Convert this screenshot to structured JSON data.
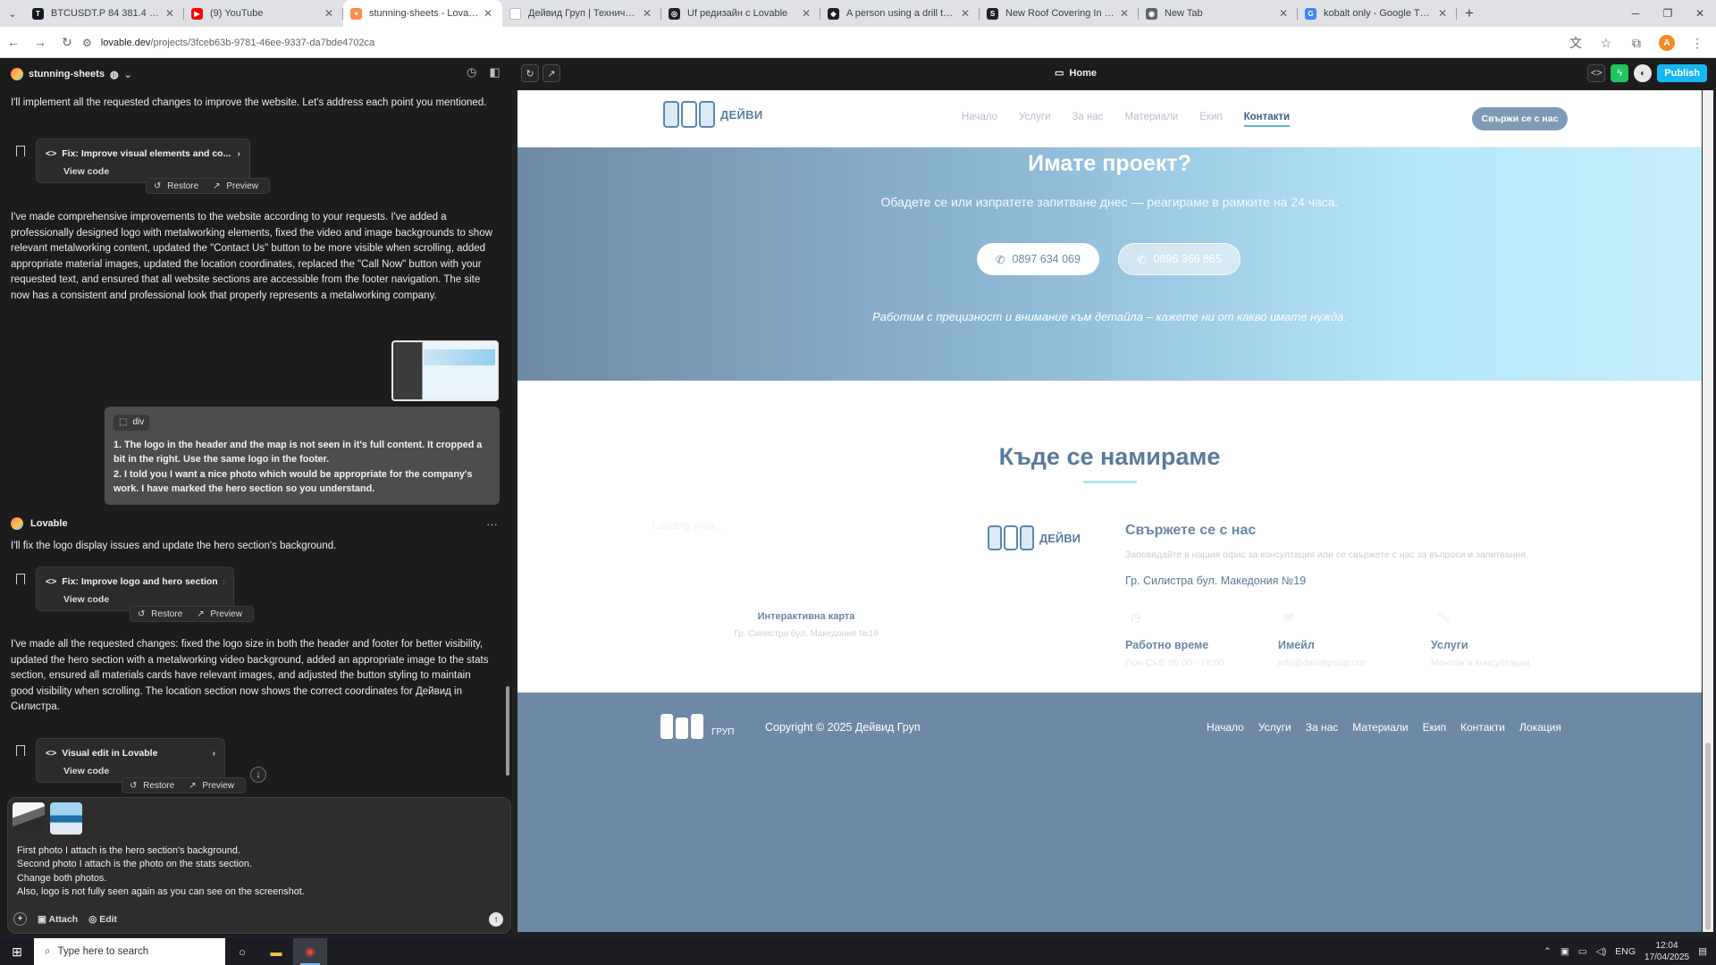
{
  "browser": {
    "tabs": [
      {
        "title": "BTCUSDT.P 84 381.4 ▲ -0.47%",
        "fav_color": "#131722",
        "fav_glyph": "T",
        "active": false
      },
      {
        "title": "(9) YouTube",
        "fav_color": "#ff0000",
        "fav_glyph": "▶",
        "active": false
      },
      {
        "title": "stunning-sheets - Lovable",
        "fav_color": "#ff8a4c",
        "fav_glyph": "♥",
        "active": true
      },
      {
        "title": "Дейвид Груп | Технически ре",
        "fav_color": "#ffffff",
        "fav_glyph": "",
        "active": false
      },
      {
        "title": "Uf редизайн с Lovable",
        "fav_color": "#202124",
        "fav_glyph": "◎",
        "active": false
      },
      {
        "title": "A person using a drill to drill a",
        "fav_color": "#202124",
        "fav_glyph": "◆",
        "active": false
      },
      {
        "title": "New Roof Covering In Progres",
        "fav_color": "#202124",
        "fav_glyph": "S",
        "active": false
      },
      {
        "title": "New Tab",
        "fav_color": "#5f6368",
        "fav_glyph": "◉",
        "active": false
      },
      {
        "title": "kobalt only - Google Търсене",
        "fav_color": "#4285f4",
        "fav_glyph": "G",
        "active": false
      }
    ],
    "url_host": "lovable.dev",
    "url_path": "/projects/3fceb63b-9781-46ee-9337-da7bde4702ca",
    "profile_initial": "A"
  },
  "app": {
    "project_name": "stunning-sheets",
    "page_selector": "Home",
    "publish_label": "Publish"
  },
  "chat": {
    "msg_intro": "I'll implement all the requested changes to improve the website. Let's address each point you mentioned.",
    "card1": {
      "title": "Fix: Improve visual elements and co...",
      "view_code": "View code",
      "restore": "Restore",
      "preview": "Preview"
    },
    "msg_summary1": "I've made comprehensive improvements to the website according to your requests. I've added a professionally designed logo with metalworking elements, fixed the video and image backgrounds to show relevant metalworking content, updated the \"Contact Us\" button to be more visible when scrolling, added appropriate material images, updated the location coordinates, replaced the \"Call Now\" button with your requested text, and ensured that all website sections are accessible from the footer navigation. The site now has a consistent and professional look that properly represents a metalworking company.",
    "user_msg": {
      "tag": "div",
      "line1": "1. The logo in the header and the map is not seen in it's full content. It cropped a bit in the right. Use the same logo in the footer.",
      "line2": "2. I told you I want a nice photo which would be appropriate for the company's work. I have marked the hero section so you understand."
    },
    "sender_name": "Lovable",
    "msg_reply": "I'll fix the logo display issues and update the hero section's background.",
    "card2": {
      "title": "Fix: Improve logo and hero section",
      "view_code": "View code",
      "restore": "Restore",
      "preview": "Preview"
    },
    "msg_summary2": "I've made all the requested changes: fixed the logo size in both the header and footer for better visibility, updated the hero section with a metalworking video background, added an appropriate image to the stats section, ensured all materials cards have relevant images, and adjusted the button styling to maintain good visibility when scrolling. The location section now shows the correct coordinates for Дейвид in Силистра.",
    "card3": {
      "title": "Visual edit in Lovable",
      "view_code": "View code",
      "restore": "Restore",
      "preview": "Preview"
    },
    "composer": {
      "lines": [
        "First photo I attach is the hero section's background.",
        "Second photo I attach is the photo on the stats section.",
        "Change both photos.",
        "Also, logo is not fully seen again as you can see on the screenshot."
      ],
      "attach_label": "Attach",
      "edit_label": "Edit"
    }
  },
  "site": {
    "logo_text": "ДЕЙВИ",
    "logo_sub": "ГРУП",
    "nav": [
      "Начало",
      "Услуги",
      "За нас",
      "Материали",
      "Екип",
      "Контакти"
    ],
    "nav_active_index": 5,
    "nav_cta": "Свържи се с нас",
    "cta": {
      "title": "Имате проект?",
      "subtitle": "Обадете се или изпратете запитване днес — реагираме в рамките на 24 часа.",
      "phone1": "0897 634 069",
      "phone2": "0896 366 865",
      "note": "Работим с прецизност и внимание към детайла – кажете ни от какво имате нужда."
    },
    "location": {
      "title": "Къде се намираме",
      "map_placeholder": "Loading map...",
      "map_label": "Интерактивна карта",
      "map_address": "Гр. Силистра бул. Македония №19",
      "contact_title": "Свържете се с нас",
      "contact_desc": "Заповядайте в нашия офис за консултация или се свържете с нас за въпроси и запитвания.",
      "contact_address": "Гр. Силистра бул. Македония №19",
      "info": [
        {
          "icon": "clock-icon",
          "label": "Работно време",
          "value": "Пон-Съб: 09:00 - 18:00"
        },
        {
          "icon": "mail-icon",
          "label": "Имейл",
          "value": "info@davidgroup.net"
        },
        {
          "icon": "wrench-icon",
          "label": "Услуги",
          "value": "Монтаж и консултации"
        }
      ]
    },
    "footer": {
      "logo_sub": "ГРУП",
      "copyright": "Copyright © 2025 Дейвид Груп",
      "links": [
        "Начало",
        "Услуги",
        "За нас",
        "Материали",
        "Екип",
        "Контакти",
        "Локация"
      ]
    },
    "colors": {
      "brand": "#6e89a6",
      "accent": "#5ab5d4",
      "cta_gradient_end": "#c5eefc"
    }
  },
  "taskbar": {
    "search_placeholder": "Type here to search",
    "lang": "ENG",
    "time": "12:04",
    "date": "17/04/2025"
  }
}
